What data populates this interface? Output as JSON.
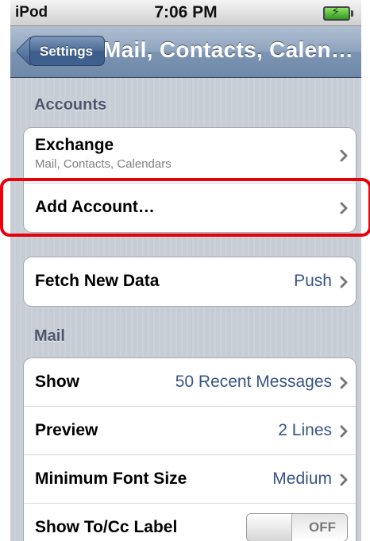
{
  "status_bar": {
    "carrier": "iPod",
    "time": "7:06 PM"
  },
  "nav": {
    "back_label": "Settings",
    "title": "Mail, Contacts, Calen…"
  },
  "sections": {
    "accounts_header": "Accounts",
    "mail_header": "Mail"
  },
  "accounts": [
    {
      "label": "Exchange",
      "subtitle": "Mail, Contacts, Calendars"
    },
    {
      "label": "Add Account…"
    }
  ],
  "fetch": {
    "label": "Fetch New Data",
    "value": "Push"
  },
  "mail": {
    "show": {
      "label": "Show",
      "value": "50 Recent Messages"
    },
    "preview": {
      "label": "Preview",
      "value": "2 Lines"
    },
    "font_size": {
      "label": "Minimum Font Size",
      "value": "Medium"
    },
    "tocc": {
      "label": "Show To/Cc Label",
      "toggle": "OFF"
    }
  },
  "colors": {
    "highlight": "#e8000b",
    "value_blue": "#385487"
  },
  "icons": [
    "chevron-right-icon",
    "battery-icon"
  ]
}
